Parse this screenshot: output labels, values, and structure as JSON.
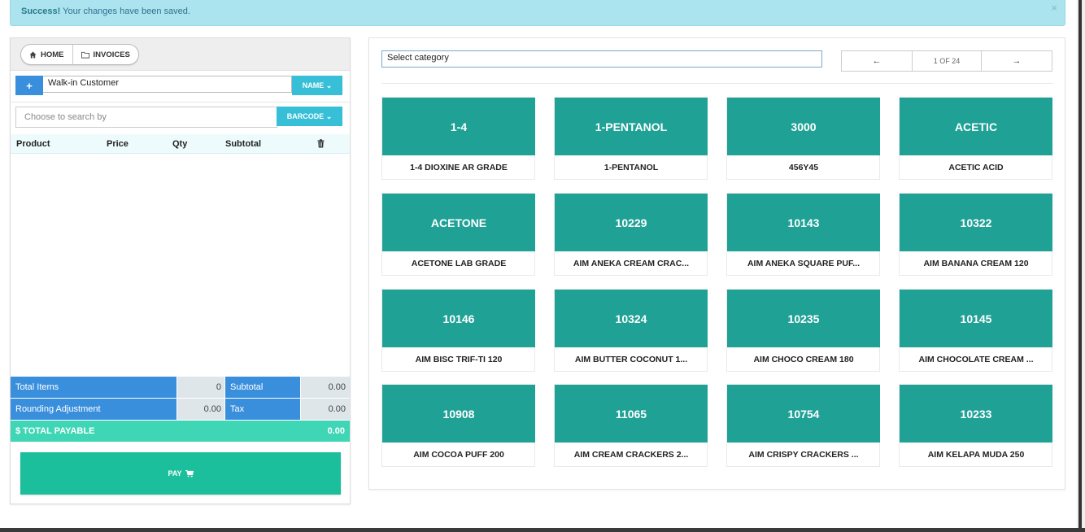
{
  "alert": {
    "strong": "Success!",
    "message": " Your changes have been saved.",
    "close": "×"
  },
  "nav": {
    "home_label": "HOME",
    "invoices_label": "INVOICES"
  },
  "customer": {
    "value": "Walk-in Customer",
    "add_label": "+",
    "name_button": "NAME ⌄"
  },
  "search": {
    "placeholder": "Choose to search by",
    "barcode_button": "BARCODE ⌄"
  },
  "cart": {
    "columns": [
      "Product",
      "Price",
      "Qty",
      "Subtotal"
    ]
  },
  "totals": {
    "total_items_label": "Total Items",
    "total_items_value": "0",
    "subtotal_label": "Subtotal",
    "subtotal_value": "0.00",
    "rounding_label": "Rounding Adjustment",
    "rounding_value": "0.00",
    "tax_label": "Tax",
    "tax_value": "0.00",
    "total_payable_label": "$ TOTAL PAYABLE",
    "total_payable_value": "0.00"
  },
  "pay": {
    "label": "PAY"
  },
  "category": {
    "selected": "Select category"
  },
  "pager": {
    "prev": "←",
    "info": "1 OF 24",
    "next": "→"
  },
  "products": [
    {
      "code": "1-4",
      "name": "1-4 DIOXINE AR GRADE"
    },
    {
      "code": "1-PENTANOL",
      "name": "1-PENTANOL"
    },
    {
      "code": "3000",
      "name": "456Y45"
    },
    {
      "code": "ACETIC",
      "name": "ACETIC ACID"
    },
    {
      "code": "ACETONE",
      "name": "ACETONE LAB GRADE"
    },
    {
      "code": "10229",
      "name": "AIM ANEKA CREAM CRAC..."
    },
    {
      "code": "10143",
      "name": "AIM ANEKA SQUARE PUF..."
    },
    {
      "code": "10322",
      "name": "AIM BANANA CREAM 120"
    },
    {
      "code": "10146",
      "name": "AIM BISC TRIF-TI 120"
    },
    {
      "code": "10324",
      "name": "AIM BUTTER COCONUT 1..."
    },
    {
      "code": "10235",
      "name": "AIM CHOCO CREAM 180"
    },
    {
      "code": "10145",
      "name": "AIM CHOCOLATE CREAM ..."
    },
    {
      "code": "10908",
      "name": "AIM COCOA PUFF 200"
    },
    {
      "code": "11065",
      "name": "AIM CREAM CRACKERS 2..."
    },
    {
      "code": "10754",
      "name": "AIM CRISPY CRACKERS ..."
    },
    {
      "code": "10233",
      "name": "AIM KELAPA MUDA 250"
    }
  ],
  "colors": {
    "card": "#1fa196",
    "blue": "#3a8fdd",
    "cyan": "#36bfd6",
    "pay": "#1cbf9b",
    "total_payable": "#3fd6b5"
  }
}
